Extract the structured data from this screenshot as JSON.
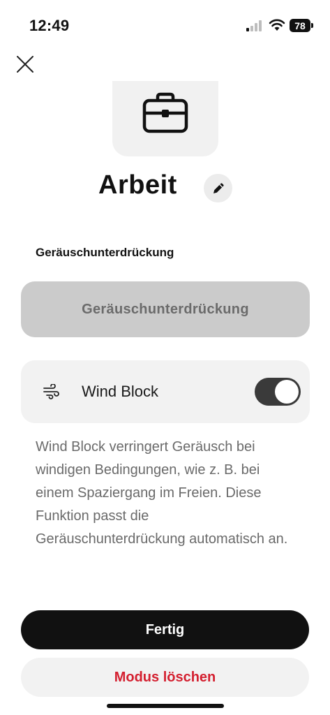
{
  "status_bar": {
    "time": "12:49",
    "battery": "78"
  },
  "mode": {
    "icon": "briefcase-icon",
    "title": "Arbeit"
  },
  "noise_cancellation": {
    "section_label": "Geräuschunterdrückung",
    "button_label": "Geräuschunterdrückung"
  },
  "wind_block": {
    "icon": "wind-icon",
    "label": "Wind Block",
    "enabled": true,
    "description": "Wind Block verringert Geräusch bei windigen Bedingungen, wie z. B. bei einem Spaziergang im Freien. Diese Funktion passt die Geräuschunterdrückung automatisch an."
  },
  "actions": {
    "done_label": "Fertig",
    "delete_label": "Modus löschen"
  },
  "colors": {
    "delete_text": "#d42030",
    "toggle_on": "#3a3a3a"
  }
}
